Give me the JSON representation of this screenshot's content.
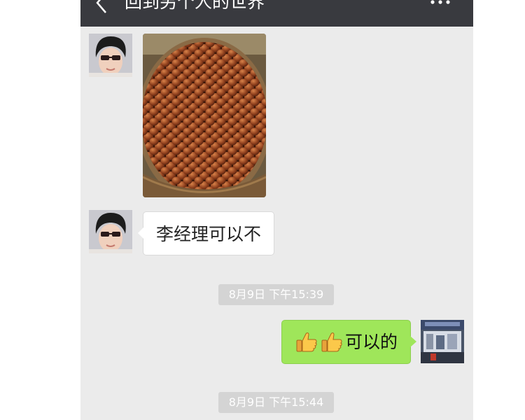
{
  "header": {
    "title": "回到另个人的世界"
  },
  "messages": [
    {
      "sender": "other",
      "type": "image",
      "image_name": "chestnuts-photo"
    },
    {
      "sender": "other",
      "type": "text",
      "text": "李经理可以不"
    },
    {
      "type": "timestamp",
      "text": "8月9日 下午15:39"
    },
    {
      "sender": "me",
      "type": "text",
      "emoji": [
        "thumbs-up",
        "thumbs-up"
      ],
      "text": "可以的"
    },
    {
      "type": "timestamp",
      "text": "8月9日 下午15:44"
    }
  ],
  "colors": {
    "header_bg": "#393a3f",
    "chat_bg": "#ebebeb",
    "sent_bubble": "#9fe65a",
    "received_bubble": "#ffffff",
    "timestamp_bg": "#d4d4d4"
  }
}
